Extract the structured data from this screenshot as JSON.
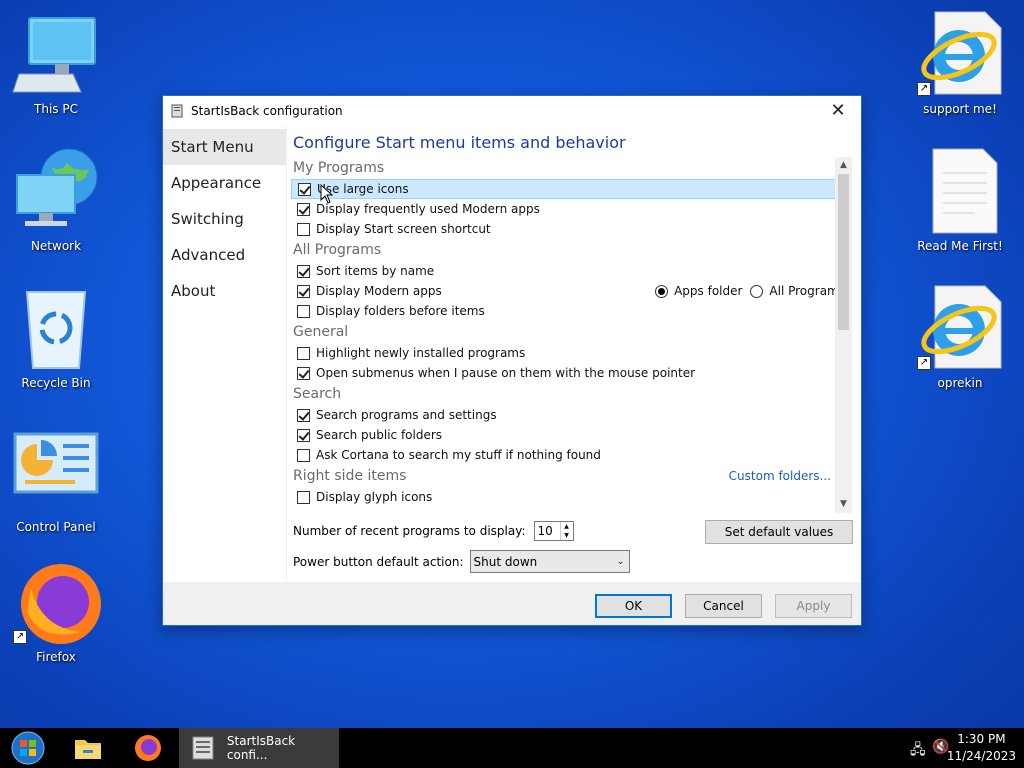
{
  "desktop": {
    "icons": [
      {
        "label": "This PC"
      },
      {
        "label": "Network"
      },
      {
        "label": "Recycle Bin"
      },
      {
        "label": "Control Panel"
      },
      {
        "label": "Firefox"
      },
      {
        "label": "support me!"
      },
      {
        "label": "Read Me First!"
      },
      {
        "label": "oprekin"
      }
    ]
  },
  "window": {
    "title": "StartIsBack configuration",
    "close_glyph": "✕",
    "nav": [
      "Start Menu",
      "Appearance",
      "Switching",
      "Advanced",
      "About"
    ],
    "heading": "Configure Start menu items and behavior",
    "sections": {
      "my_programs": {
        "title": "My Programs",
        "items": [
          {
            "label": "Use large icons",
            "checked": true
          },
          {
            "label": "Display frequently used Modern apps",
            "checked": true
          },
          {
            "label": "Display Start screen shortcut",
            "checked": false
          }
        ]
      },
      "all_programs": {
        "title": "All Programs",
        "items": [
          {
            "label": "Sort items by name",
            "checked": true
          },
          {
            "label": "Display Modern apps",
            "checked": true
          },
          {
            "label": "Display folders before items",
            "checked": false
          }
        ],
        "radio_apps_folder": "Apps folder",
        "radio_all_programs": "All Programs",
        "radio_selected": "Apps folder"
      },
      "general": {
        "title": "General",
        "items": [
          {
            "label": "Highlight newly installed programs",
            "checked": false
          },
          {
            "label": "Open submenus when I pause on them with the mouse pointer",
            "checked": true
          }
        ]
      },
      "search": {
        "title": "Search",
        "items": [
          {
            "label": "Search programs and settings",
            "checked": true
          },
          {
            "label": "Search public folders",
            "checked": true
          },
          {
            "label": "Ask Cortana to search my stuff if nothing found",
            "checked": false
          }
        ]
      },
      "right_side": {
        "title": "Right side items",
        "link": "Custom folders...",
        "items": [
          {
            "label": "Display glyph icons",
            "checked": false
          }
        ]
      }
    },
    "recent_label": "Number of recent programs to display:",
    "recent_value": "10",
    "defaults_button": "Set default values",
    "power_label": "Power button default action:",
    "power_value": "Shut down",
    "ok": "OK",
    "cancel": "Cancel",
    "apply": "Apply"
  },
  "taskbar": {
    "active_window": "StartIsBack confi...",
    "time": "1:30 PM",
    "date": "11/24/2023"
  }
}
